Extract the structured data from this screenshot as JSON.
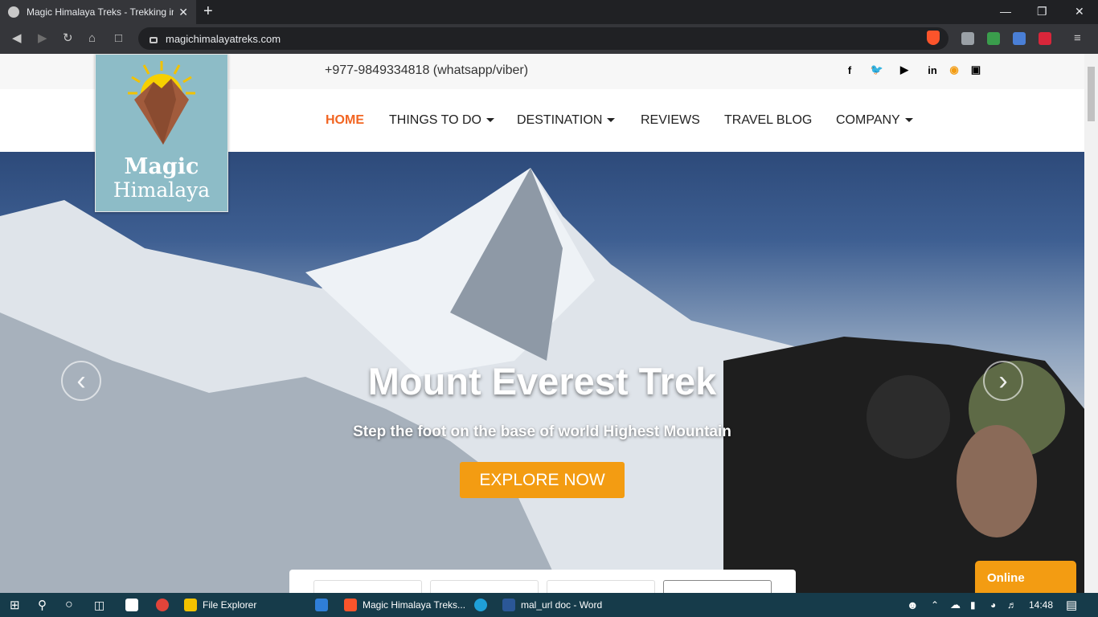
{
  "browser": {
    "tab_title": "Magic Himalaya Treks - Trekking in",
    "url": "magichimalayatreks.com",
    "close_glyph": "✕",
    "new_tab_glyph": "+"
  },
  "site": {
    "phone": "+977-9849334818 (whatsapp/viber)",
    "logo_line1": "Magic",
    "logo_line2": "Himalaya",
    "social_icons": [
      "facebook-icon",
      "twitter-icon",
      "youtube-icon",
      "linkedin-icon",
      "pinterest-icon",
      "instagram-icon"
    ],
    "nav": [
      {
        "label": "HOME",
        "active": true
      },
      {
        "label": "THINGS TO DO",
        "dropdown": true
      },
      {
        "label": "DESTINATION",
        "dropdown": true
      },
      {
        "label": "REVIEWS"
      },
      {
        "label": "TRAVEL BLOG"
      },
      {
        "label": "COMPANY",
        "dropdown": true
      }
    ],
    "hero": {
      "title": "Mount Everest Trek",
      "subtitle": "Step the foot on the base of world Highest Mountain",
      "cta": "EXPLORE NOW"
    },
    "chat_widget": "Online",
    "accent_color": "#f39c12",
    "active_nav_color": "#f26522"
  },
  "taskbar": {
    "file_explorer": "File Explorer",
    "browser_window": "Magic Himalaya Treks...",
    "word_window": "mal_url doc - Word",
    "time": "14:48"
  }
}
